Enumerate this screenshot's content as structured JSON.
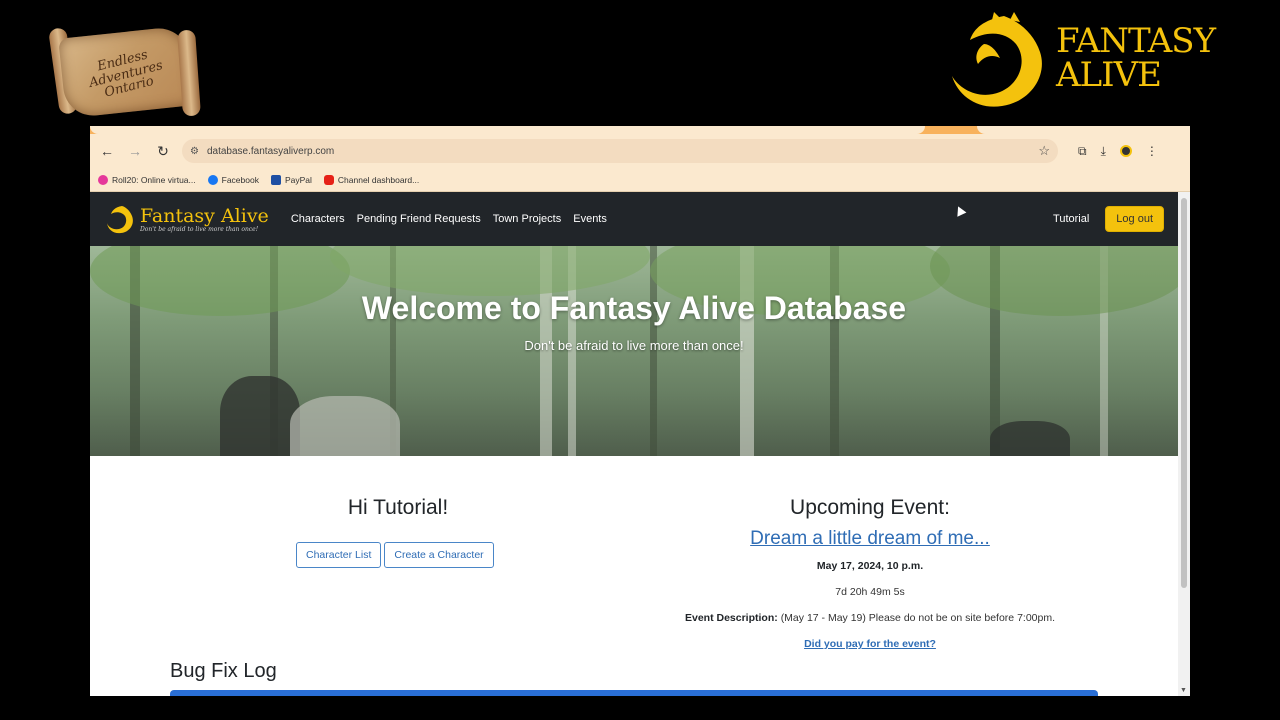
{
  "overlay": {
    "left_logo_text": "Endless Adventures Ontario",
    "right_brand_line1": "FANTASY",
    "right_brand_line2": "ALIVE"
  },
  "browser": {
    "url": "database.fantasyaliverp.com",
    "bookmarks": [
      {
        "label": "Roll20: Online virtua...",
        "icon": "roll20-icon",
        "color": "#e5389a"
      },
      {
        "label": "Facebook",
        "icon": "facebook-icon",
        "color": "#1877f2"
      },
      {
        "label": "PayPal",
        "icon": "paypal-icon",
        "color": "#1f4fa3"
      },
      {
        "label": "Channel dashboard...",
        "icon": "youtube-icon",
        "color": "#e62117"
      }
    ]
  },
  "site": {
    "logo_name": "Fantasy Alive",
    "logo_tagline": "Don't be afraid to live more than once!",
    "nav_links": [
      "Characters",
      "Pending Friend Requests",
      "Town Projects",
      "Events"
    ],
    "nav_user": "Tutorial",
    "logout_label": "Log out",
    "accent": "#f4c20d",
    "navbar_bg": "#212529"
  },
  "hero": {
    "title": "Welcome to Fantasy Alive Database",
    "subtitle": "Don't be afraid to live more than once!"
  },
  "main": {
    "greeting": "Hi Tutorial!",
    "buttons": [
      "Character List",
      "Create a Character"
    ],
    "event": {
      "heading": "Upcoming Event:",
      "name": "Dream a little dream of me...",
      "date": "May 17, 2024, 10 p.m.",
      "countdown": "7d 20h 49m 5s",
      "description_label": "Event Description:",
      "description": "(May 17 - May 19) Please do not be on site before 7:00pm.",
      "pay_link": "Did you pay for the event?"
    },
    "bug_log_title": "Bug Fix Log",
    "link_color": "#2f6db5"
  }
}
